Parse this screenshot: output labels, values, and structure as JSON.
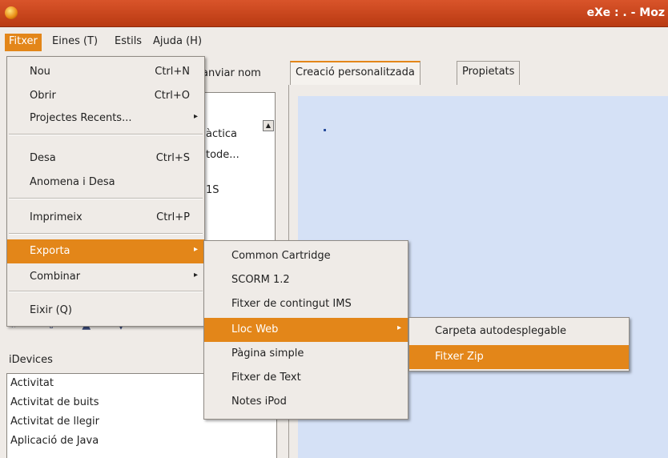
{
  "window": {
    "title": "eXe : . - Moz"
  },
  "menubar": {
    "items": [
      "Fitxer",
      "Eines (T)",
      "Estils",
      "Ajuda (H)"
    ]
  },
  "left_panel": {
    "rename_button": "anviar nom",
    "outline_items": [
      "àctica",
      "tode...",
      "1S"
    ],
    "nav_arrows": "⇤ ⇧ ▲ ▼",
    "idevices_label": "iDevices",
    "idevices": [
      "Activitat",
      "Activitat de buits",
      "Activitat de llegir",
      "Aplicació de Java"
    ]
  },
  "tabs": [
    "Creació personalitzada",
    "Propietats"
  ],
  "file_menu": {
    "items": [
      {
        "label": "Nou",
        "accel": "Ctrl+N"
      },
      {
        "label": "Obrir",
        "accel": "Ctrl+O"
      },
      {
        "label": "Projectes Recents...",
        "submenu": true
      },
      {
        "label": "Desa",
        "accel": "Ctrl+S"
      },
      {
        "label": "Anomena i Desa"
      },
      {
        "label": "Imprimeix",
        "accel": "Ctrl+P"
      },
      {
        "label": "Exporta",
        "submenu": true,
        "highlighted": true
      },
      {
        "label": "Combinar",
        "submenu": true
      },
      {
        "label": "Eixir (Q)"
      }
    ]
  },
  "export_menu": {
    "items": [
      {
        "label": "Common Cartridge"
      },
      {
        "label": "SCORM 1.2"
      },
      {
        "label": "Fitxer de contingut IMS"
      },
      {
        "label": "Lloc Web",
        "submenu": true,
        "highlighted": true
      },
      {
        "label": "Pàgina simple"
      },
      {
        "label": "Fitxer de Text"
      },
      {
        "label": "Notes iPod"
      }
    ]
  },
  "web_menu": {
    "items": [
      {
        "label": "Carpeta autodesplegable"
      },
      {
        "label": "Fitxer Zip",
        "highlighted": true
      }
    ]
  },
  "colors": {
    "highlight": "#e38619",
    "titlebar": "#c9471c",
    "canvas": "#d5e1f6"
  }
}
